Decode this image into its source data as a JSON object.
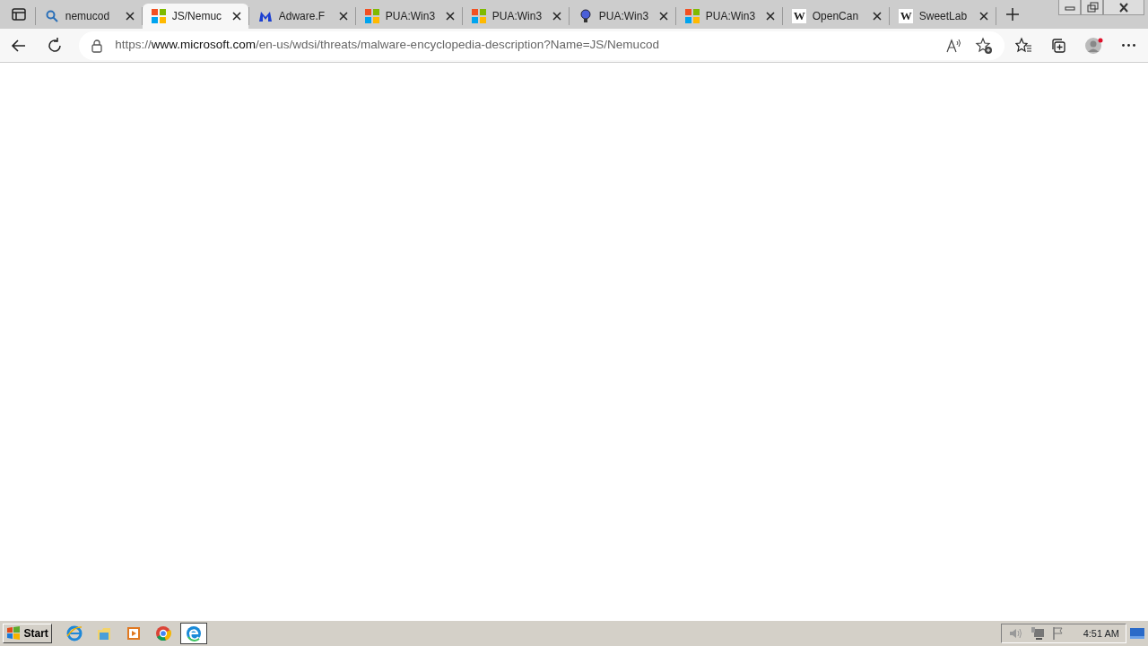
{
  "tabs": [
    {
      "kind": "search",
      "title": "nemucod",
      "selected": false
    },
    {
      "kind": "windows",
      "title": "JS/Nemuc",
      "selected": true
    },
    {
      "kind": "malwarebytes",
      "title": "Adware.F",
      "selected": false
    },
    {
      "kind": "windows",
      "title": "PUA:Win3",
      "selected": false
    },
    {
      "kind": "windows",
      "title": "PUA:Win3",
      "selected": false
    },
    {
      "kind": "bulb",
      "title": "PUA:Win3",
      "selected": false
    },
    {
      "kind": "windows",
      "title": "PUA:Win3",
      "selected": false
    },
    {
      "kind": "letter",
      "glyph": "W",
      "title": "OpenCan",
      "selected": false
    },
    {
      "kind": "letter",
      "glyph": "W",
      "title": "SweetLab",
      "selected": false
    }
  ],
  "address_bar": {
    "scheme": "https://",
    "host": "www.microsoft.com",
    "path": "/en-us/wdsi/threats/malware-encyclopedia-description?Name=JS/Nemucod"
  },
  "taskbar": {
    "start_label": "Start",
    "apps": [
      {
        "kind": "ie",
        "selected": false
      },
      {
        "kind": "folder",
        "selected": false
      },
      {
        "kind": "media",
        "selected": false
      },
      {
        "kind": "chrome",
        "selected": false
      },
      {
        "kind": "edge",
        "selected": true
      }
    ],
    "clock": "4:51 AM"
  }
}
